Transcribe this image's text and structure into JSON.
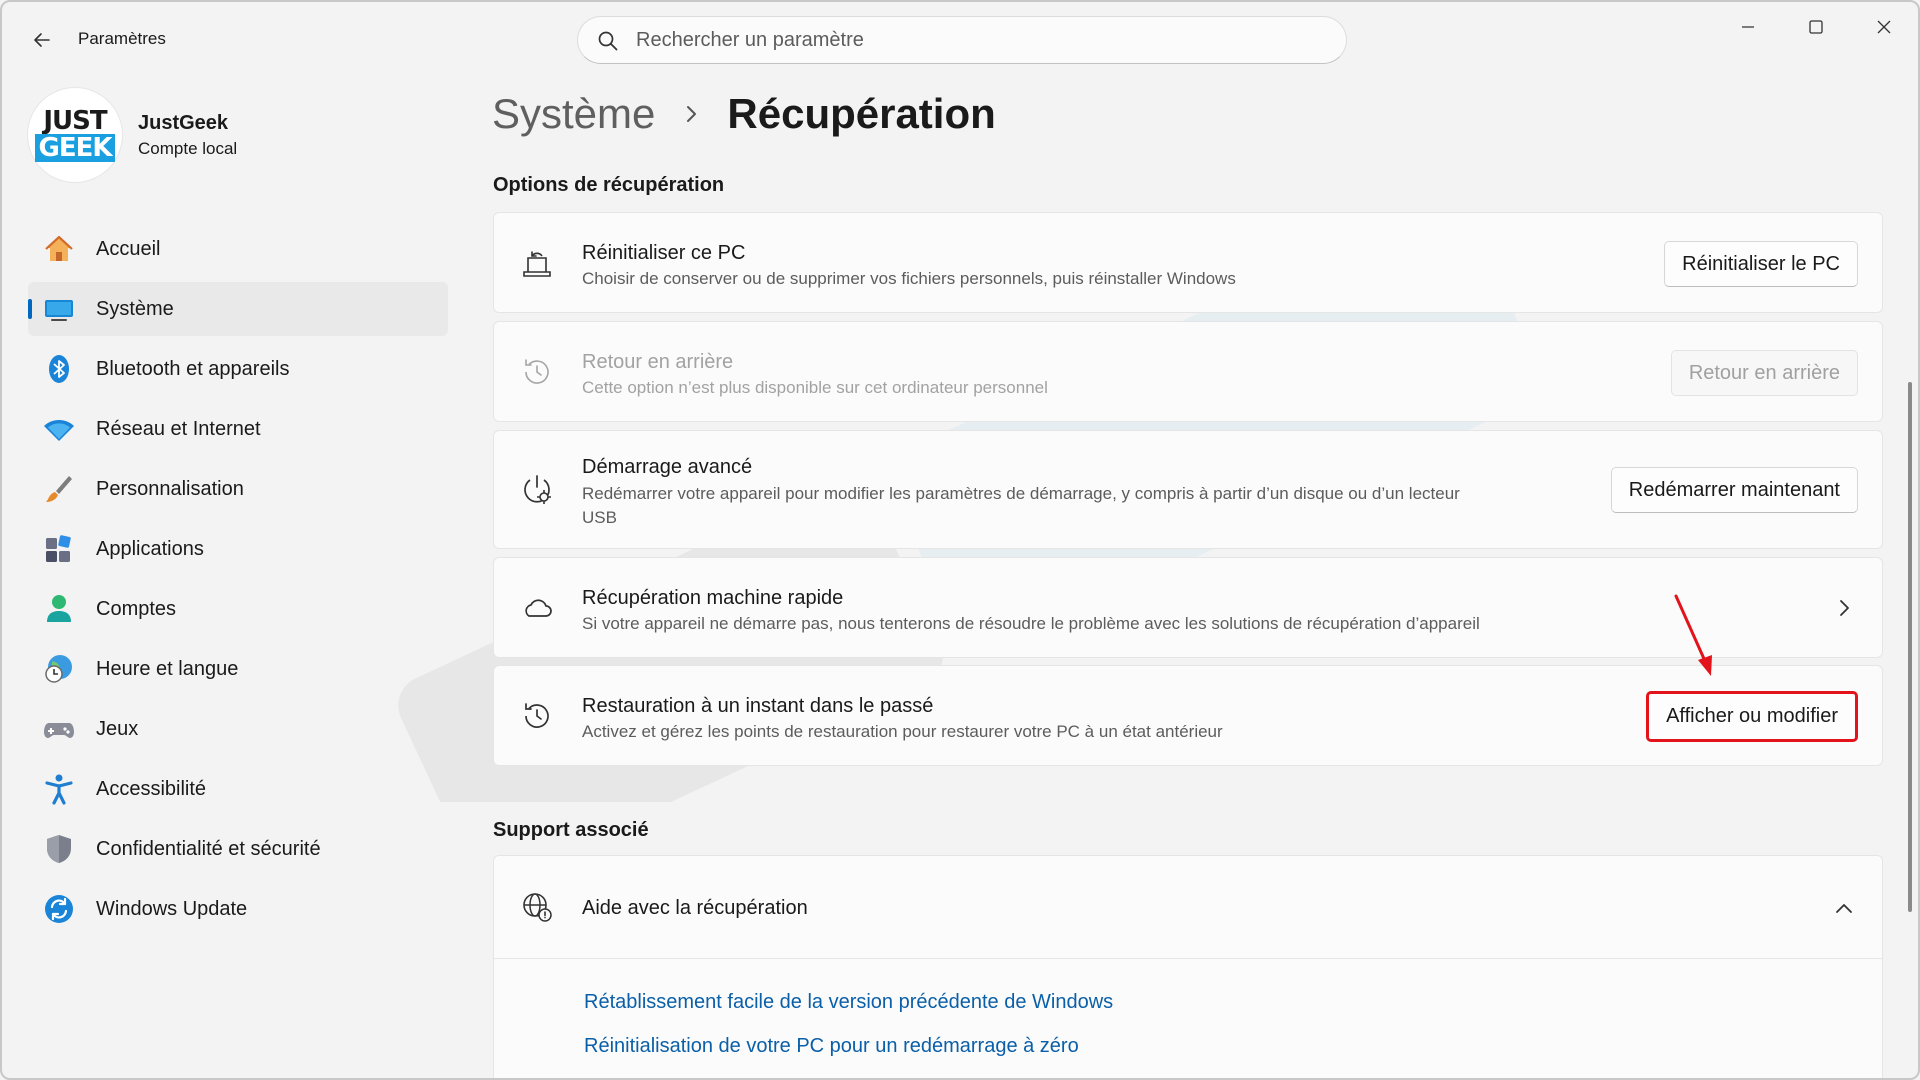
{
  "window": {
    "app_title": "Paramètres",
    "search_placeholder": "Rechercher un paramètre"
  },
  "profile": {
    "logo_top": "JUST",
    "logo_bottom": "GEEK",
    "name": "JustGeek",
    "account": "Compte local"
  },
  "nav": [
    {
      "label": "Accueil",
      "icon": "home-icon"
    },
    {
      "label": "Système",
      "icon": "system-icon",
      "active": true
    },
    {
      "label": "Bluetooth et appareils",
      "icon": "bluetooth-icon"
    },
    {
      "label": "Réseau et Internet",
      "icon": "wifi-icon"
    },
    {
      "label": "Personnalisation",
      "icon": "brush-icon"
    },
    {
      "label": "Applications",
      "icon": "apps-icon"
    },
    {
      "label": "Comptes",
      "icon": "account-icon"
    },
    {
      "label": "Heure et langue",
      "icon": "clock-globe-icon"
    },
    {
      "label": "Jeux",
      "icon": "gamepad-icon"
    },
    {
      "label": "Accessibilité",
      "icon": "accessibility-icon"
    },
    {
      "label": "Confidentialité et sécurité",
      "icon": "shield-icon"
    },
    {
      "label": "Windows Update",
      "icon": "update-icon"
    }
  ],
  "breadcrumb": {
    "parent": "Système",
    "current": "Récupération"
  },
  "recovery": {
    "section_title": "Options de récupération",
    "items": [
      {
        "title": "Réinitialiser ce PC",
        "desc": "Choisir de conserver ou de supprimer vos fichiers personnels, puis réinstaller Windows",
        "button": "Réinitialiser le PC",
        "icon": "reset-pc-icon"
      },
      {
        "title": "Retour en arrière",
        "desc": "Cette option n’est plus disponible sur cet ordinateur personnel",
        "button": "Retour en arrière",
        "icon": "history-icon",
        "disabled": true
      },
      {
        "title": "Démarrage avancé",
        "desc_line1": "Redémarrer votre appareil pour modifier les paramètres de démarrage, y compris à partir d’un disque ou d’un lecteur",
        "desc_line2": "USB",
        "button": "Redémarrer maintenant",
        "icon": "advanced-startup-icon"
      },
      {
        "title": "Récupération machine rapide",
        "desc": "Si votre appareil ne démarre pas, nous tenterons de résoudre le problème avec les solutions de récupération d’appareil",
        "icon": "cloud-icon"
      },
      {
        "title": "Restauration à un instant dans le passé",
        "desc": "Activez et gérez les points de restauration pour restaurer votre PC à un état antérieur",
        "button": "Afficher ou modifier",
        "icon": "restore-icon"
      }
    ]
  },
  "support": {
    "section_title": "Support associé",
    "help_title": "Aide avec la récupération",
    "links": [
      "Rétablissement facile de la version précédente de Windows",
      "Réinitialisation de votre PC pour un redémarrage à zéro"
    ]
  },
  "colors": {
    "accent": "#0067c0",
    "highlight": "#e3131b",
    "link": "#0a5fa8"
  }
}
